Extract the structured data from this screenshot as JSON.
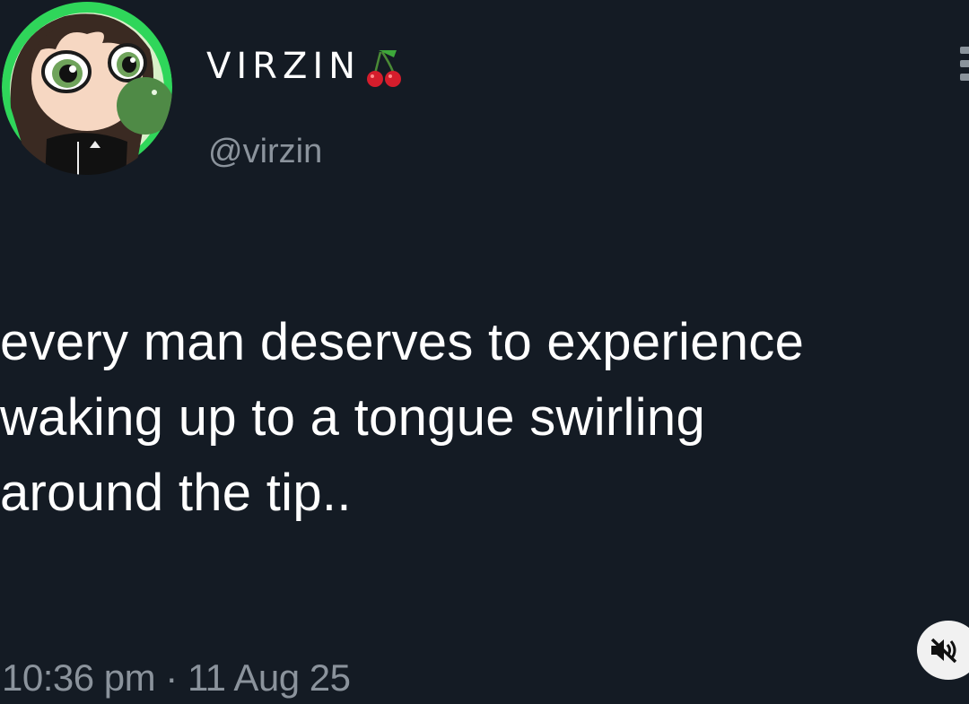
{
  "post": {
    "display_name": "VIRZIN",
    "handle": "@virzin",
    "text": "every man deserves to experience\nwaking up to a tongue swirling\naround the tip..",
    "timestamp": "10:36 pm · 11 Aug 25"
  },
  "icons": {
    "avatar": "cartoon-girl-avatar",
    "name_emoji": "cherries-icon",
    "more": "more-options-icon",
    "mute": "speaker-muted-icon"
  },
  "colors": {
    "background": "#141b24",
    "text_primary": "#ffffff",
    "text_secondary": "#8b939c",
    "avatar_ring": "#2fd65a"
  }
}
